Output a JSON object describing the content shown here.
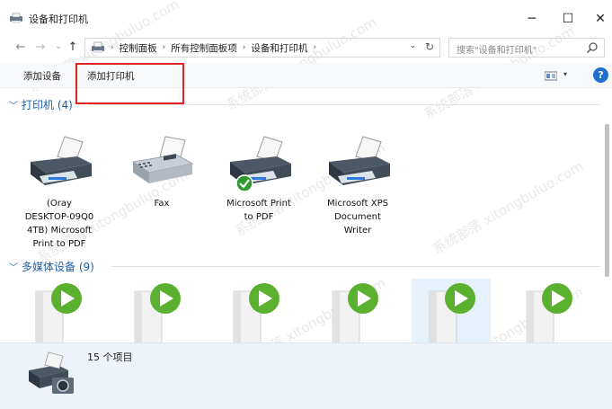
{
  "window": {
    "title": "设备和打印机",
    "controls": {
      "minimize": "─",
      "maximize": "☐",
      "close": "✕"
    }
  },
  "nav": {
    "back": "←",
    "forward": "→",
    "recent": "⌄",
    "up": "↑",
    "breadcrumbs": [
      "控制面板",
      "所有控制面板项",
      "设备和打印机"
    ],
    "crumb_sep": "›",
    "dropdown": "⌄",
    "refresh": "↻"
  },
  "search": {
    "placeholder": "搜索\"设备和打印机\""
  },
  "commands": {
    "add_device": "添加设备",
    "add_printer": "添加打印机",
    "help": "?",
    "view_dd": "▾"
  },
  "groups": {
    "printers": {
      "chevron": "﹀",
      "title": "打印机 (4)"
    },
    "multimedia": {
      "chevron": "﹀",
      "title": "多媒体设备 (9)"
    }
  },
  "printers": [
    {
      "label_lines": [
        "(Oray",
        "DESKTOP-09Q0",
        "4TB) Microsoft",
        "Print to PDF"
      ]
    },
    {
      "label_lines": [
        "Fax"
      ]
    },
    {
      "label_lines": [
        "Microsoft Print",
        "to PDF"
      ],
      "default": true
    },
    {
      "label_lines": [
        "Microsoft XPS",
        "Document",
        "Writer"
      ]
    }
  ],
  "media_devices_visible": 6,
  "details": {
    "count_text": "15 个项目"
  },
  "watermark": "系统部落 xitongbuluo.com",
  "colors": {
    "accent": "#1e5fa8",
    "highlight_box": "#e02424",
    "play_green": "#5cb030",
    "default_check": "#2e9a2e",
    "details_bg": "#eef3f9"
  }
}
